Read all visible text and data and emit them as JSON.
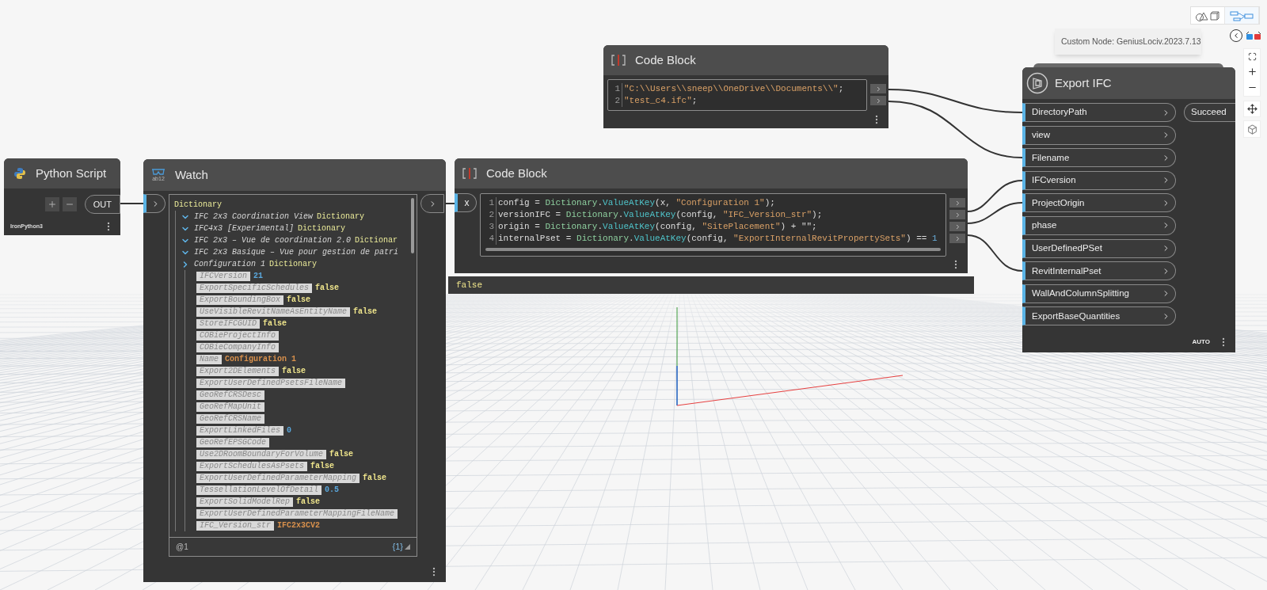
{
  "view_toggle": [
    {
      "kind": "geometry",
      "selected": false
    },
    {
      "kind": "graph",
      "selected": true
    }
  ],
  "tooltip": {
    "text": "Custom Node: GeniusLociv.2023.7.13"
  },
  "python_node": {
    "title": "Python Script",
    "output": "OUT",
    "engine": "IronPython3"
  },
  "watch_node": {
    "title": "Watch",
    "icon_text": "ab12",
    "tree": {
      "label": "Dictionary",
      "children": [
        {
          "kind": "group",
          "name": "IFC 2x3 Coordination View",
          "type": "Dictionary",
          "expanded": true
        },
        {
          "kind": "group",
          "name": "IFC4x3 [Experimental]",
          "type": "Dictionary",
          "expanded": true
        },
        {
          "kind": "group",
          "name": "IFC 2x3 – Vue de coordination 2.0",
          "type": "Dictionar",
          "expanded": true
        },
        {
          "kind": "group",
          "name": "IFC 2x3 Basique – Vue pour gestion de patri",
          "expanded": true
        },
        {
          "kind": "group",
          "name": "Configuration 1",
          "type": "Dictionary",
          "expanded": false,
          "children": [
            {
              "kind": "entry",
              "key": "IFCVersion",
              "value": "21",
              "color": "#5aa7dc"
            },
            {
              "kind": "entry",
              "key": "ExportSpecificSchedules",
              "value": "false",
              "color": "#f0e68c"
            },
            {
              "kind": "entry",
              "key": "ExportBoundingBox",
              "value": "false",
              "color": "#f0e68c"
            },
            {
              "kind": "entry",
              "key": "UseVisibleRevitNameAsEntityName",
              "value": "false",
              "color": "#f0e68c"
            },
            {
              "kind": "entry",
              "key": "StoreIFCGUID",
              "value": "false",
              "color": "#f0e68c"
            },
            {
              "kind": "entry",
              "key": "COBieProjectInfo"
            },
            {
              "kind": "entry",
              "key": "COBieCompanyInfo"
            },
            {
              "kind": "entry",
              "key": "Name",
              "value": "Configuration 1",
              "color": "#d8904c"
            },
            {
              "kind": "entry",
              "key": "Export2DElements",
              "value": "false",
              "color": "#f0e68c"
            },
            {
              "kind": "entry",
              "key": "ExportUserDefinedPsetsFileName"
            },
            {
              "kind": "entry",
              "key": "GeoRefCRSDesc"
            },
            {
              "kind": "entry",
              "key": "GeoRefMapUnit"
            },
            {
              "kind": "entry",
              "key": "GeoRefCRSName"
            },
            {
              "kind": "entry",
              "key": "ExportLinkedFiles",
              "value": "0",
              "color": "#5aa7dc"
            },
            {
              "kind": "entry",
              "key": "GeoRefEPSGCode"
            },
            {
              "kind": "entry",
              "key": "Use2DRoomBoundaryForVolume",
              "value": "false",
              "color": "#f0e68c"
            },
            {
              "kind": "entry",
              "key": "ExportSchedulesAsPsets",
              "value": "false",
              "color": "#f0e68c"
            },
            {
              "kind": "entry",
              "key": "ExportUserDefinedParameterMapping",
              "value": "false",
              "color": "#f0e68c"
            },
            {
              "kind": "entry",
              "key": "TessellationLevelOfDetail",
              "value": "0.5",
              "color": "#5aa7dc"
            },
            {
              "kind": "entry",
              "key": "ExportSolidModelRep",
              "value": "false",
              "color": "#f0e68c"
            },
            {
              "kind": "entry",
              "key": "ExportUserDefinedParameterMappingFileName"
            },
            {
              "kind": "entry",
              "key": "IFC_Version_str",
              "value": "IFC2x3CV2",
              "color": "#d8904c"
            }
          ]
        }
      ]
    },
    "footer_left": "@1",
    "footer_right": "{1}"
  },
  "code_block_main": {
    "title": "Code Block",
    "input": "x",
    "lines": [
      {
        "number": "1",
        "tokens": [
          {
            "text": "config = ",
            "kind": "plain"
          },
          {
            "text": "Dictionary",
            "kind": "class"
          },
          {
            "text": ".",
            "kind": "plain"
          },
          {
            "text": "ValueAtKey",
            "kind": "method"
          },
          {
            "text": "(x, ",
            "kind": "plain"
          },
          {
            "text": "\"Configuration 1\"",
            "kind": "string"
          },
          {
            "text": ");",
            "kind": "plain"
          }
        ]
      },
      {
        "number": "2",
        "tokens": [
          {
            "text": "versionIFC = ",
            "kind": "plain"
          },
          {
            "text": "Dictionary",
            "kind": "class"
          },
          {
            "text": ".",
            "kind": "plain"
          },
          {
            "text": "ValueAtKey",
            "kind": "method"
          },
          {
            "text": "(config, ",
            "kind": "plain"
          },
          {
            "text": "\"IFC_Version_str\"",
            "kind": "string"
          },
          {
            "text": ");",
            "kind": "plain"
          }
        ]
      },
      {
        "number": "3",
        "tokens": [
          {
            "text": "origin = ",
            "kind": "plain"
          },
          {
            "text": "Dictionary",
            "kind": "class"
          },
          {
            "text": ".",
            "kind": "plain"
          },
          {
            "text": "ValueAtKey",
            "kind": "method"
          },
          {
            "text": "(config, ",
            "kind": "plain"
          },
          {
            "text": "\"SitePlacement\"",
            "kind": "string"
          },
          {
            "text": ") + \"\";",
            "kind": "plain"
          }
        ]
      },
      {
        "number": "4",
        "tokens": [
          {
            "text": "internalPset = ",
            "kind": "plain"
          },
          {
            "text": "Dictionary",
            "kind": "class"
          },
          {
            "text": ".",
            "kind": "plain"
          },
          {
            "text": "ValueAtKey",
            "kind": "method"
          },
          {
            "text": "(config, ",
            "kind": "plain"
          },
          {
            "text": "\"ExportInternalRevitPropertySets\"",
            "kind": "string"
          },
          {
            "text": ") == ",
            "kind": "plain"
          },
          {
            "text": "1",
            "kind": "number"
          }
        ]
      }
    ],
    "preview": "false"
  },
  "code_block_top": {
    "title": "Code Block",
    "lines": [
      {
        "number": "1",
        "tokens": [
          {
            "text": "\"C:\\\\Users\\\\sneep\\\\OneDrive\\\\Documents\\\\\"",
            "kind": "string"
          },
          {
            "text": ";",
            "kind": "plain"
          }
        ]
      },
      {
        "number": "2",
        "tokens": [
          {
            "text": "\"test_c4.ifc\"",
            "kind": "string"
          },
          {
            "text": ";",
            "kind": "plain"
          }
        ]
      }
    ]
  },
  "export_node": {
    "title": "Export IFC",
    "inputs": [
      {
        "label": "DirectoryPath"
      },
      {
        "label": "view"
      },
      {
        "label": "Filename"
      },
      {
        "label": "IFCversion"
      },
      {
        "label": "ProjectOrigin"
      },
      {
        "label": "phase"
      },
      {
        "label": "UserDefinedPSet"
      },
      {
        "label": "RevitInternalPset"
      },
      {
        "label": "WallAndColumnSplitting"
      },
      {
        "label": "ExportBaseQuantities"
      }
    ],
    "output": "Succeed",
    "run_mode": "AUTO"
  }
}
